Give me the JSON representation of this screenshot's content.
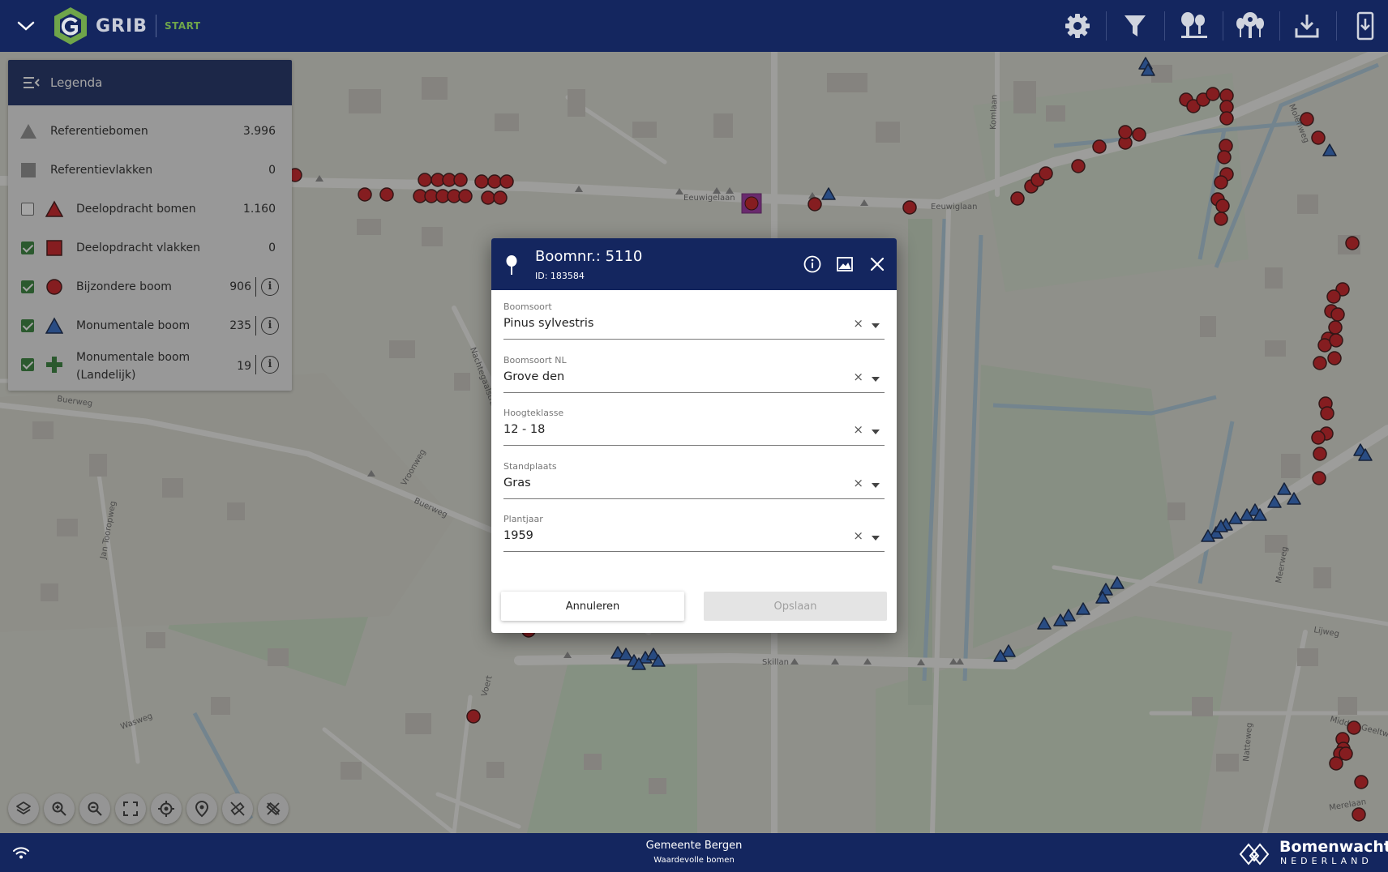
{
  "header": {
    "brand": "GRIB",
    "module": "START"
  },
  "legend": {
    "title": "Legenda",
    "items": [
      {
        "label": "Referentiebomen",
        "count": "3.996",
        "checkbox": "none",
        "symbol": "triangle",
        "color": "#8a8a8a"
      },
      {
        "label": "Referentievlakken",
        "count": "0",
        "checkbox": "none",
        "symbol": "square",
        "color": "#8a8a8a"
      },
      {
        "label": "Deelopdracht bomen",
        "count": "1.160",
        "checkbox": "off",
        "symbol": "triangle",
        "color": "#c8151b"
      },
      {
        "label": "Deelopdracht vlakken",
        "count": "0",
        "checkbox": "on",
        "symbol": "square",
        "color": "#c8151b"
      },
      {
        "label": "Bijzondere boom",
        "count": "906",
        "checkbox": "on",
        "symbol": "circle",
        "color": "#c8151b",
        "info": "i"
      },
      {
        "label": "Monumentale boom",
        "count": "235",
        "checkbox": "on",
        "symbol": "triangle",
        "color": "#2a66c4",
        "info": "i"
      },
      {
        "label": "Monumentale boom (Landelijk)",
        "count": "19",
        "checkbox": "on",
        "symbol": "plus",
        "color": "#2e7d32",
        "info": "i"
      }
    ]
  },
  "map": {
    "street_labels": [
      "Eeuwigelaan",
      "Eeuwiglaan",
      "Komlaan",
      "Buerweg",
      "Buerweg",
      "Nachtegaalstraat",
      "Jan Tooropweg",
      "Vroonweg",
      "Voert",
      "Skillan",
      "Wasweg",
      "Molenweg",
      "Meerweg",
      "Lijweg",
      "Midden Geeltweg",
      "Merelaan",
      "Natteweg"
    ]
  },
  "map_controls": [
    "layers-icon",
    "zoom-in-icon",
    "zoom-out-icon",
    "fullscreen-icon",
    "locate-icon",
    "place-marker-icon",
    "measure-icon",
    "clear-measure-icon"
  ],
  "dialog": {
    "title": "Boomnr.: 5110",
    "subtitle": "ID: 183584",
    "fields": [
      {
        "label": "Boomsoort",
        "value": "Pinus sylvestris"
      },
      {
        "label": "Boomsoort NL",
        "value": "Grove den"
      },
      {
        "label": "Hoogteklasse",
        "value": "12 - 18"
      },
      {
        "label": "Standplaats",
        "value": "Gras"
      },
      {
        "label": "Plantjaar",
        "value": "1959"
      }
    ],
    "clear_glyph": "×",
    "cancel_label": "Annuleren",
    "save_label": "Opslaan"
  },
  "footer": {
    "organization": "Gemeente Bergen",
    "project": "Waardevolle bomen",
    "partner_name": "Bomenwacht",
    "partner_country": "NEDERLAND"
  },
  "colors": {
    "navy": "#14265f",
    "marker_red": "#c8151b",
    "marker_blue": "#2a66c4",
    "check_green": "#2e7d32",
    "brand_green": "#6fa54a"
  }
}
